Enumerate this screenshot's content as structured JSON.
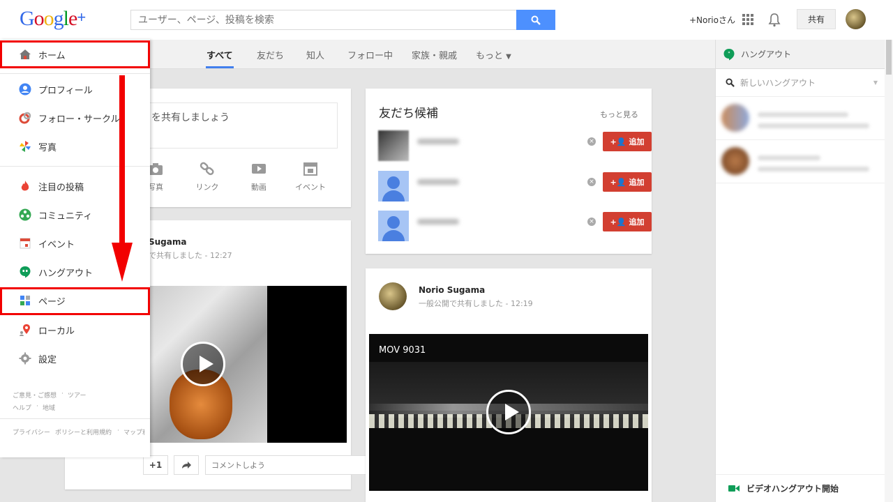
{
  "header": {
    "logo_text": "Google",
    "logo_plus": "+",
    "search_placeholder": "ユーザー、ページ、投稿を検索",
    "user_name": "+Norioさん",
    "share_label": "共有"
  },
  "tabs": [
    {
      "label": "すべて",
      "active": true
    },
    {
      "label": "友だち"
    },
    {
      "label": "知人"
    },
    {
      "label": "フォロー中"
    },
    {
      "label": "家族・親戚"
    },
    {
      "label": "もっと"
    }
  ],
  "menu": {
    "items": [
      {
        "label": "ホーム",
        "icon": "home-icon"
      },
      {
        "label": "プロフィール",
        "icon": "profile-icon"
      },
      {
        "label": "フォロー・サークル",
        "icon": "circles-icon"
      },
      {
        "label": "写真",
        "icon": "photos-icon"
      },
      {
        "label": "注目の投稿",
        "icon": "whats-hot-icon"
      },
      {
        "label": "コミュニティ",
        "icon": "communities-icon"
      },
      {
        "label": "イベント",
        "icon": "events-icon"
      },
      {
        "label": "ハングアウト",
        "icon": "hangouts-icon"
      },
      {
        "label": "ページ",
        "icon": "pages-icon"
      },
      {
        "label": "ローカル",
        "icon": "local-icon"
      },
      {
        "label": "設定",
        "icon": "settings-icon"
      }
    ],
    "footer_links": [
      "ご意見・ご感想",
      "ツアー",
      "ヘルプ",
      "地域",
      "プライバシー",
      "ポリシーと利用規約",
      "マップ利用規約"
    ]
  },
  "share_card": {
    "prompt": "を共有しましょう",
    "actions": [
      {
        "label": "写真",
        "icon": "camera-icon"
      },
      {
        "label": "リンク",
        "icon": "link-icon"
      },
      {
        "label": "動画",
        "icon": "video-icon"
      },
      {
        "label": "イベント",
        "icon": "event-icon"
      }
    ]
  },
  "post1": {
    "author": "Sugama",
    "meta_shared": "で共有しました",
    "meta_time": "12:27",
    "plus_one": "+1",
    "comment_placeholder": "コメントしよう"
  },
  "suggestions": {
    "title": "友だち候補",
    "more": "もっと見る",
    "add_label": "追加",
    "rows": 3
  },
  "post2": {
    "author": "Norio Sugama",
    "meta_shared": "一般公開で共有しました",
    "meta_time": "12:19",
    "video_title": "MOV 9031"
  },
  "hangouts": {
    "title": "ハングアウト",
    "new_placeholder": "新しいハングアウト",
    "footer": "ビデオハングアウト開始"
  },
  "colors": {
    "accent_blue": "#4d90fe",
    "tab_underline": "#427fed",
    "add_button": "#d23f31",
    "highlight_red": "#f20000"
  }
}
